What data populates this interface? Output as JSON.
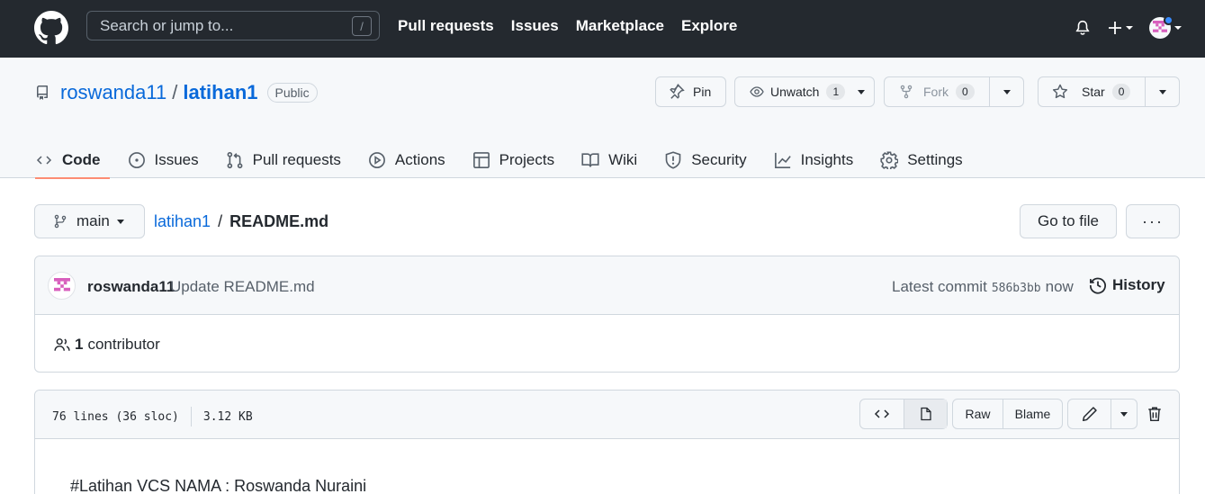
{
  "header": {
    "search_placeholder": "Search or jump to...",
    "search_key": "/",
    "nav": [
      "Pull requests",
      "Issues",
      "Marketplace",
      "Explore"
    ]
  },
  "repo": {
    "owner": "roswanda11",
    "separator": "/",
    "name": "latihan1",
    "visibility": "Public",
    "pin_label": "Pin",
    "watch_label": "Unwatch",
    "watch_count": "1",
    "fork_label": "Fork",
    "fork_count": "0",
    "star_label": "Star",
    "star_count": "0"
  },
  "tabs": [
    {
      "label": "Code",
      "icon": "code-icon",
      "active": true
    },
    {
      "label": "Issues",
      "icon": "issue-icon"
    },
    {
      "label": "Pull requests",
      "icon": "pull-request-icon"
    },
    {
      "label": "Actions",
      "icon": "play-icon"
    },
    {
      "label": "Projects",
      "icon": "table-icon"
    },
    {
      "label": "Wiki",
      "icon": "book-icon"
    },
    {
      "label": "Security",
      "icon": "shield-icon"
    },
    {
      "label": "Insights",
      "icon": "graph-icon"
    },
    {
      "label": "Settings",
      "icon": "gear-icon"
    }
  ],
  "file_nav": {
    "branch": "main",
    "crumb_repo": "latihan1",
    "crumb_sep": "/",
    "crumb_file": "README.md",
    "goto_label": "Go to file",
    "more_label": "···"
  },
  "commit": {
    "author": "roswanda11",
    "message": "Update README.md",
    "latest_label": "Latest commit",
    "sha": "586b3bb",
    "time": "now",
    "history_label": "History",
    "contributors_count": "1",
    "contributors_label": "contributor"
  },
  "file": {
    "lines_info": "76 lines (36 sloc)",
    "size": "3.12 KB",
    "raw_label": "Raw",
    "blame_label": "Blame",
    "content_first_line": "#Latihan VCS NAMA : Roswanda Nuraini"
  },
  "colors": {
    "header_bg": "#24292f",
    "link": "#0969da",
    "tab_underline": "#fd8c73",
    "notification_dot": "#388bfd"
  }
}
